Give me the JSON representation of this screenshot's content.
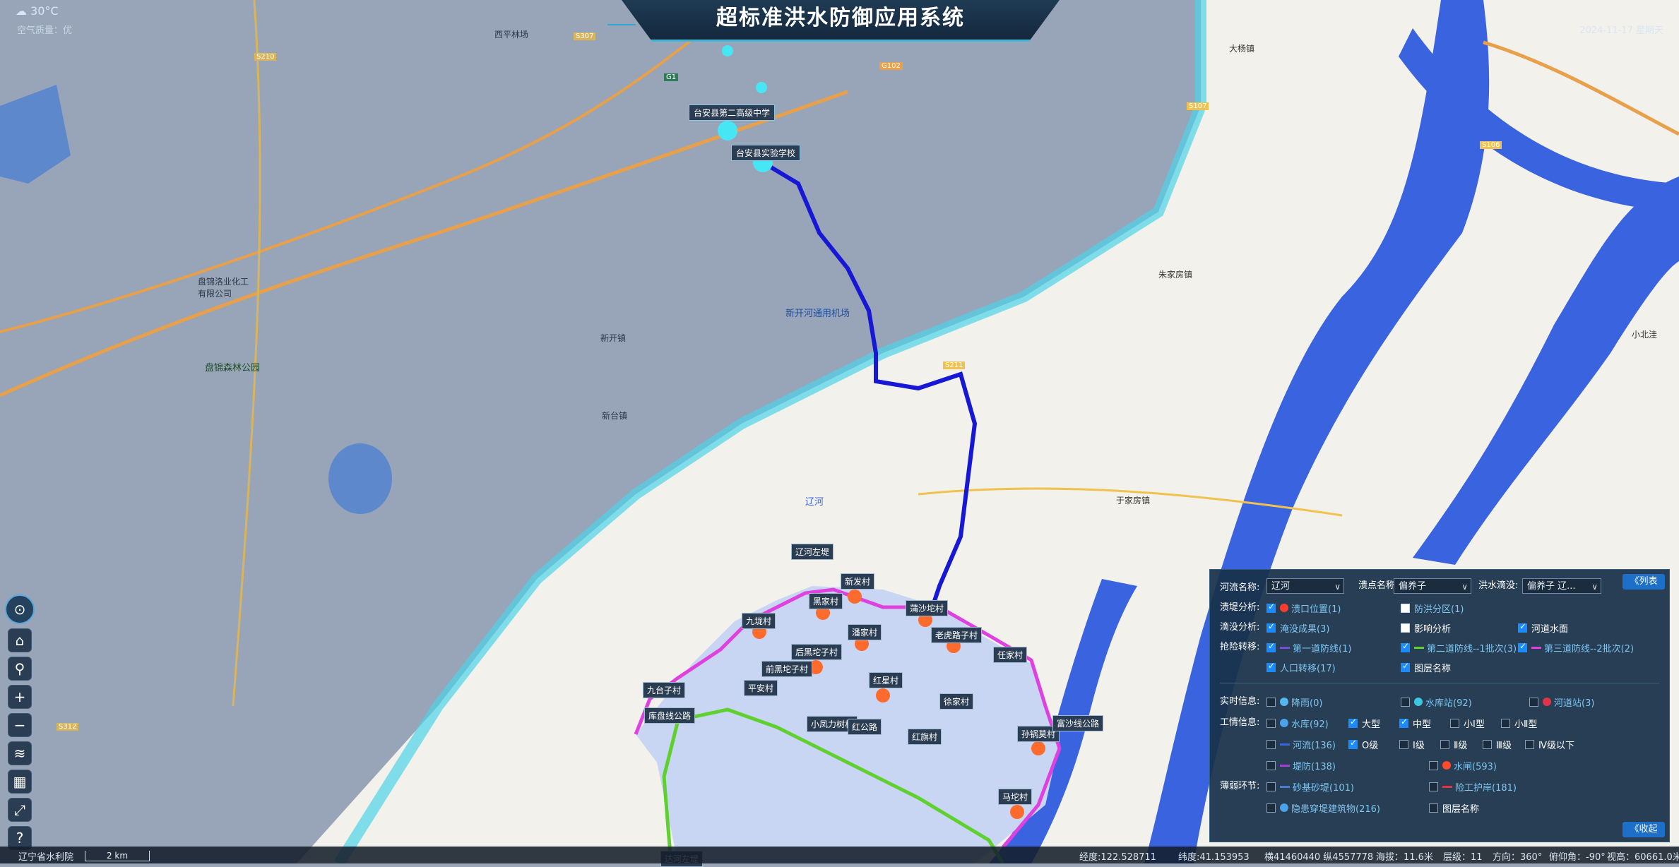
{
  "header": {
    "title": "超标准洪水防御应用系统",
    "weather": "30°C",
    "air_quality": "空气质量：优",
    "date": "2024-11-17 星期天"
  },
  "map_labels": {
    "schools": [
      "台安县第二高级中学",
      "台安县实验学校"
    ],
    "villages": [
      {
        "name": "辽河左堤"
      },
      {
        "name": "新发村"
      },
      {
        "name": "黑家村"
      },
      {
        "name": "九垅村"
      },
      {
        "name": "蒲沙坨村"
      },
      {
        "name": "潘家村"
      },
      {
        "name": "老虎路子村"
      },
      {
        "name": "后黑坨子村"
      },
      {
        "name": "前黑坨子村"
      },
      {
        "name": "任家村"
      },
      {
        "name": "红星村"
      },
      {
        "name": "九台子村"
      },
      {
        "name": "平安村"
      },
      {
        "name": "库盘线公路"
      },
      {
        "name": "徐家村"
      },
      {
        "name": "小凤力树村"
      },
      {
        "name": "红公路"
      },
      {
        "name": "红旗村"
      },
      {
        "name": "孙锅莫村"
      },
      {
        "name": "富沙线公路"
      },
      {
        "name": "马坨村"
      },
      {
        "name": "达河左堤"
      }
    ],
    "places": [
      "新开河通用机场",
      "盘锦森林公园",
      "盘锦洛业化工有限公司",
      "辽河",
      "西平林场",
      "新开镇",
      "于家房镇",
      "朱家房镇",
      "新台镇",
      "大杨镇",
      "小北洼"
    ],
    "roads": [
      "G102",
      "G1",
      "S107",
      "S211",
      "S210",
      "S106",
      "S307",
      "S312"
    ]
  },
  "panel": {
    "list_button": "《列表",
    "collapse_button": "《收起",
    "river_label": "河流名称:",
    "river_value": "辽河",
    "break_label": "溃点名称:",
    "break_value": "偏养子",
    "flood_label": "洪水滴没:",
    "flood_value": "偏养子 辽...",
    "row_labels": {
      "dike": "溃堤分析:",
      "flood": "滴没分析:",
      "rescue": "抢险转移:",
      "realtime": "实时信息:",
      "engineering": "工情信息:",
      "weak": "薄弱环节:"
    },
    "checks": {
      "break_position": "溃口位置(1)",
      "flood_zone": "防洪分区(1)",
      "flood_result": "淹没成果(3)",
      "impact": "影响分析",
      "river_surface": "河道水面",
      "line1": "第一道防线(1)",
      "line2a": "第二道防线--1批次(3)",
      "line2b": "第三道防线--2批次(2)",
      "transfer": "人口转移(17)",
      "layer_name": "图层名称",
      "rain": "降雨(0)",
      "reservoir_station": "水库站(92)",
      "river_station": "河道站(3)",
      "reservoir": "水库(92)",
      "large": "大型",
      "medium": "中型",
      "small1": "小Ⅰ型",
      "small2": "小Ⅱ型",
      "river": "河流(136)",
      "grade0": "O级",
      "grade1": "Ⅰ级",
      "grade2": "Ⅱ级",
      "grade3": "Ⅲ级",
      "grade4": "Ⅳ级以下",
      "embankment": "堤防(138)",
      "sluice": "水闸(593)",
      "sand_base": "砂基砂堤(101)",
      "revetment": "险工护岸(181)",
      "hidden_building": "隐患穿堤建筑物(216)",
      "layer_name2": "图层名称"
    }
  },
  "status_bar": {
    "org": "辽宁省水利院",
    "scale": "2 km",
    "lon": "经度:122.528711",
    "lat": "纬度:41.153953",
    "xy": "横41460440 纵4557778",
    "altitude": "海拔：11.6米",
    "level": "层级：11",
    "heading": "方向：360°",
    "pitch": "俯仰角：-90°",
    "height": "视高：60661.0米"
  },
  "colors": {
    "accent": "#1d6fc7",
    "flood_area": "#c7d6f2",
    "river_blue": "#3a63e0",
    "boundary_magenta": "#e040e0",
    "route_blue": "#1717d6",
    "line_green": "#5fd12f"
  }
}
